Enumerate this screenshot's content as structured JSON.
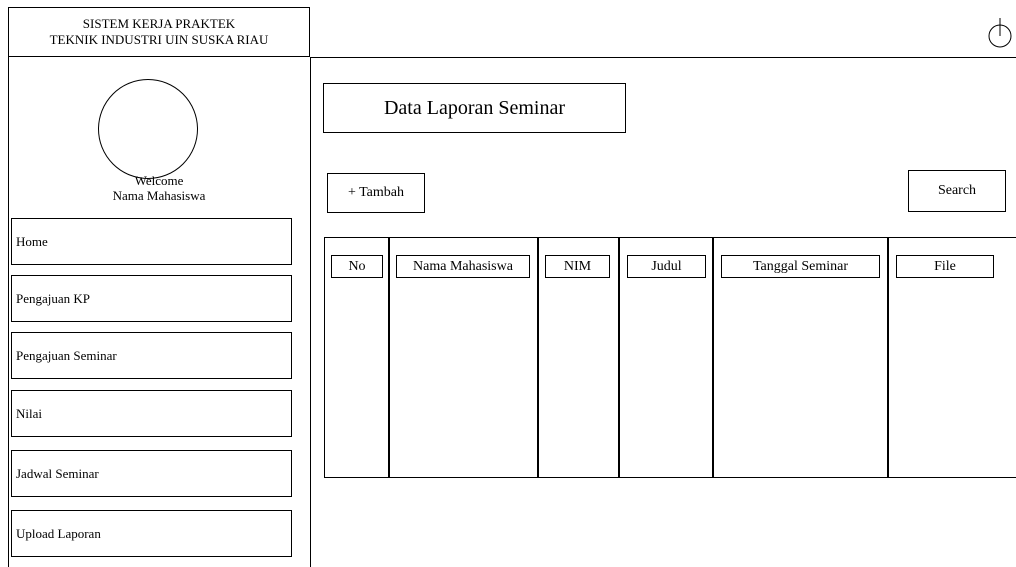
{
  "header": {
    "brand_line1": "SISTEM KERJA PRAKTEK",
    "brand_line2": "TEKNIK INDUSTRI UIN SUSKA RIAU",
    "power_icon": "power-icon"
  },
  "sidebar": {
    "welcome": "Welcome",
    "user_name": "Nama Mahasiswa",
    "items": [
      {
        "label": "Home"
      },
      {
        "label": "Pengajuan KP"
      },
      {
        "label": "Pengajuan Seminar"
      },
      {
        "label": "Nilai"
      },
      {
        "label": "Jadwal Seminar"
      },
      {
        "label": "Upload Laporan"
      }
    ]
  },
  "main": {
    "title": "Data Laporan Seminar",
    "add_label": "+ Tambah",
    "search_label": "Search",
    "table": {
      "columns": [
        "No",
        "Nama Mahasiswa",
        "NIM",
        "Judul",
        "Tanggal Seminar",
        "File"
      ],
      "rows": []
    }
  }
}
